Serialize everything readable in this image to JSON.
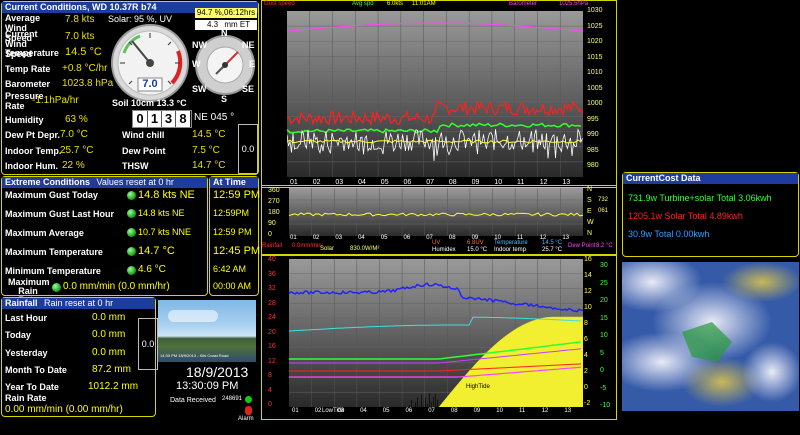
{
  "current": {
    "title": "Current Conditions, WD 10.37R b74",
    "avg_wind_label": "Average Wind Speed",
    "avg_wind_value": "7.8 kts",
    "solar_text": "Solar: 95 %, UV",
    "cur_wind_label": "Current Wind Speed",
    "cur_wind_value": "7.0 kts",
    "temp_label": "Temperature",
    "temp_value": "14.5 °C",
    "temprate_label": "Temp Rate",
    "temprate_value": "+0.8 °C/hr",
    "baro_label": "Barometer",
    "baro_value": "1023.8 hPa",
    "pressrate_label": "Pressure Rate",
    "pressrate_value": "-1.1hPa/hr",
    "humidity_label": "Humidity",
    "humidity_value": "63 %",
    "dewdepr_label": "Dew Pt Depr.",
    "dewdepr_value": "7.0 °C",
    "indoortemp_label": "Indoor Temp.",
    "indoortemp_value": "25.7 °C",
    "indoorhum_label": "Indoor Hum.",
    "indoorhum_value": "22 %",
    "windchill_label": "Wind chill",
    "windchill_value": "14.5 °C",
    "dewpoint_label": "Dew Point",
    "dewpoint_value": "7.5 °C",
    "thsw_label": "THSW",
    "thsw_value": "14.7 °C",
    "sun_pct": "94.7 %,06:12hrs",
    "et_value": "4.3",
    "et_unit": "mm ET",
    "gauge_value": "7.0",
    "soil_text": "Soil 10cm 13.3 °C",
    "odometer": [
      "0",
      "1",
      "3",
      "8"
    ],
    "wind_dir": "NE  045 °",
    "side_value": "0.0",
    "compass": {
      "n": "N",
      "s": "S",
      "e": "E",
      "w": "W",
      "ne": "NE",
      "nw": "NW",
      "se": "SE",
      "sw": "SW"
    }
  },
  "extreme": {
    "title": "Extreme Conditions",
    "subtitle": "Values reset at 0 hr",
    "rows": [
      {
        "label": "Maximum Gust Today",
        "value": "14.8 kts  NE"
      },
      {
        "label": "Maximum Gust Last Hour",
        "value": "14.8 kts  NE"
      },
      {
        "label": "Maximum Average",
        "value": "10.7 kts NNE"
      },
      {
        "label": "Maximum Temperature",
        "value": "14.7 °C"
      },
      {
        "label": "Minimum Temperature",
        "value": "4.6 °C"
      },
      {
        "label": "Maximum Rain Rate",
        "value": "0.0 mm/min (0.0 mm/hr)"
      }
    ]
  },
  "attime": {
    "title": "At Time",
    "times": [
      "12:59 PM",
      "12:59PM",
      "12:59 PM",
      "12:45 PM",
      "6:42 AM",
      "00:00 AM"
    ]
  },
  "rainfall": {
    "title": "Rainfall",
    "subtitle": "Rain reset at 0 hr",
    "rows": [
      {
        "label": "Last Hour",
        "value": "0.0 mm"
      },
      {
        "label": "Today",
        "value": "0.0 mm"
      },
      {
        "label": "Yesterday",
        "value": "0.0 mm"
      },
      {
        "label": "Month To Date",
        "value": "87.2 mm"
      },
      {
        "label": "Year To Date",
        "value": "1012.2 mm"
      }
    ],
    "rainrate_label": "Rain Rate",
    "rainrate_value": "0.00 mm/min (0.00 mm/hr)",
    "side_value": "0.0"
  },
  "status": {
    "date": "18/9/2013",
    "time": "13:30:09 PM",
    "data_received_label": "Data Received",
    "data_received_value": "248691",
    "alarm_label": "Alarm",
    "webcam_caption": "14:30 PM 18/9/2013 - Kihi Coast Road"
  },
  "graph1": {
    "labels": [
      "Gust speed",
      "Avg spd",
      "6.0kts",
      "11:01AM",
      "Barometer",
      "1025.5hPa"
    ],
    "right_ticks": [
      "1030",
      "1025",
      "1020",
      "1015",
      "1010",
      "1005",
      "1000",
      "995",
      "990",
      "985",
      "980"
    ],
    "x_ticks": [
      "01",
      "02",
      "03",
      "04",
      "05",
      "06",
      "07",
      "08",
      "09",
      "10",
      "11",
      "12",
      "13"
    ]
  },
  "graph2": {
    "left_ticks": [
      "360",
      "270",
      "180",
      "90",
      "0"
    ],
    "right_letters": [
      "N",
      "S",
      "E",
      "W",
      "N"
    ],
    "right_values": [
      "732",
      "061"
    ],
    "x_ticks": [
      "01",
      "02",
      "03",
      "04",
      "05",
      "06",
      "07",
      "08",
      "09",
      "10",
      "11",
      "12",
      "13"
    ],
    "legend": [
      "Rainfall",
      "0.0mm/min",
      "Solar",
      "830.0W/M²",
      "UV",
      "6.8UV",
      "Humidex",
      "15.0 °C",
      "Temperature",
      "14.5 °C",
      "Indoor temp",
      "25.7 °C",
      "Dew Point",
      "8.2 °C"
    ]
  },
  "graph3": {
    "left_ticks": [
      "40",
      "36",
      "32",
      "28",
      "24",
      "20",
      "16",
      "12",
      "8",
      "4",
      "0"
    ],
    "right_ticks": [
      "16",
      "14",
      "12",
      "10",
      "8",
      "6",
      "4",
      "2",
      "0",
      "-2"
    ],
    "right_ticks2": [
      "30",
      "25",
      "20",
      "15",
      "10",
      "5",
      "0",
      "-5",
      "-10"
    ],
    "x_ticks": [
      "01",
      "02",
      "03",
      "04",
      "05",
      "06",
      "07",
      "08",
      "09",
      "10",
      "11",
      "12",
      "13"
    ],
    "low_tide": "LowTide",
    "high_tide": "HighTide"
  },
  "currentcost": {
    "title": "CurrentCost Data",
    "line1": "731.9w Turbine+solar Total 3.06kwh",
    "line2": "1205.1w Solar Total 4.89kwh",
    "line3": "30.9w  Total 0.00kwh",
    "color1": "#33ff33",
    "color2": "#ff2222",
    "color3": "#33a0ff"
  },
  "colors": {
    "panel_border": "#d8d400",
    "header_bg": "#1e3c9e",
    "accent": "#ffff00"
  }
}
